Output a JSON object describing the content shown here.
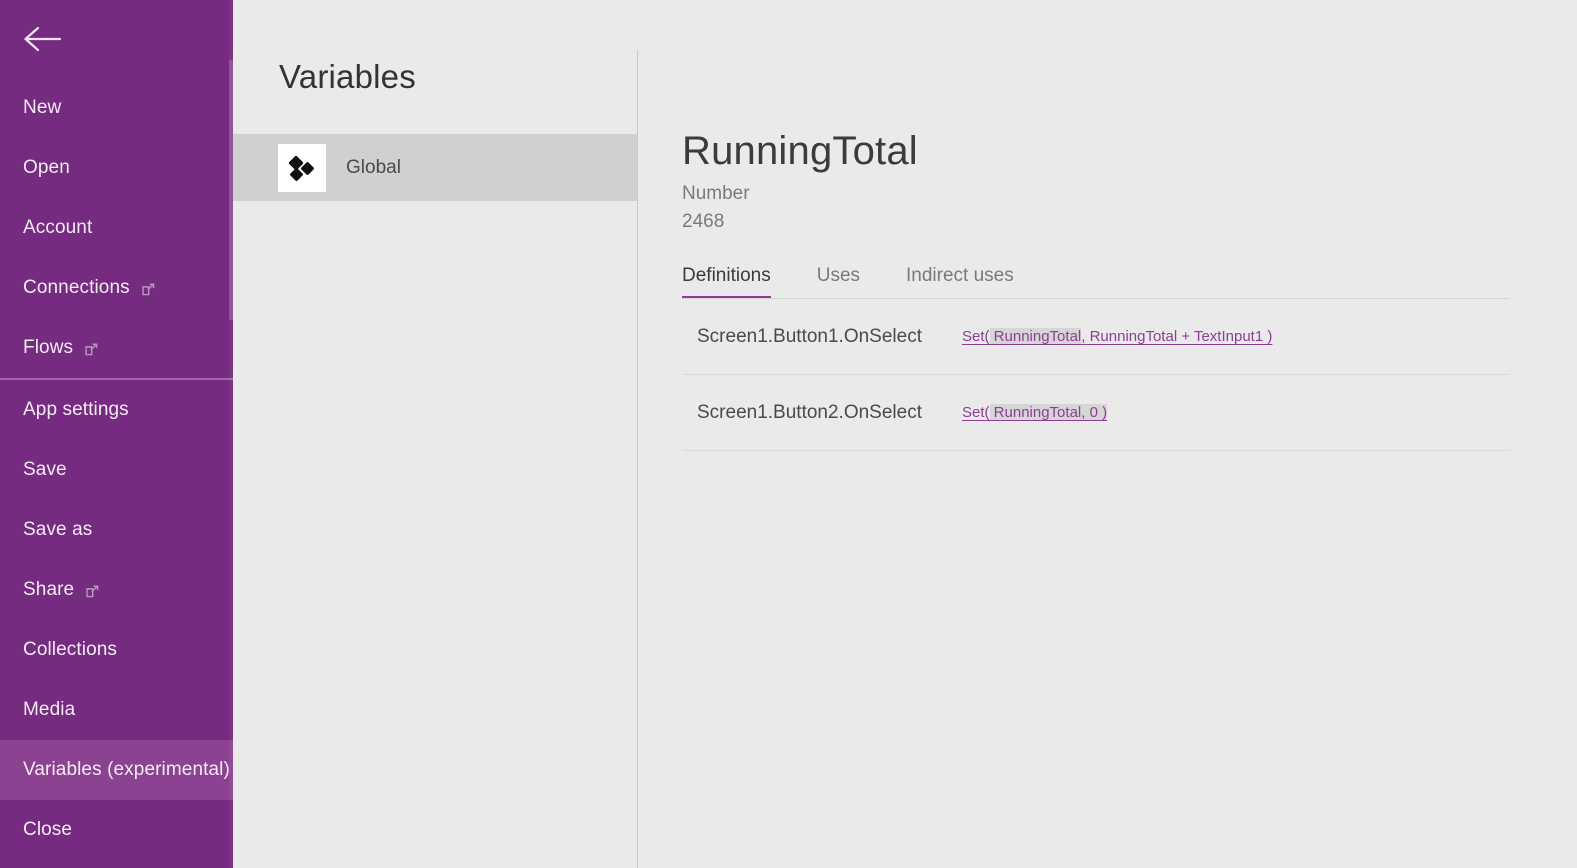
{
  "theme": {
    "sidebar_purple": "#752B7F",
    "sidebar_selected_purple": "#8B4391",
    "accent_purple": "#8C3E92",
    "panel_background": "#EAEAEA",
    "list_selected_gray": "#D0D0D0",
    "highlight_gray": "#D6D6D6"
  },
  "sidebar": {
    "back_icon": "back-arrow-icon",
    "items": [
      {
        "label": "New",
        "external": false,
        "selected": false,
        "separator_after": false
      },
      {
        "label": "Open",
        "external": false,
        "selected": false,
        "separator_after": false
      },
      {
        "label": "Account",
        "external": false,
        "selected": false,
        "separator_after": false
      },
      {
        "label": "Connections",
        "external": true,
        "selected": false,
        "separator_after": false
      },
      {
        "label": "Flows",
        "external": true,
        "selected": false,
        "separator_after": true
      },
      {
        "label": "App settings",
        "external": false,
        "selected": false,
        "separator_after": false
      },
      {
        "label": "Save",
        "external": false,
        "selected": false,
        "separator_after": false
      },
      {
        "label": "Save as",
        "external": false,
        "selected": false,
        "separator_after": false
      },
      {
        "label": "Share",
        "external": true,
        "selected": false,
        "separator_after": false
      },
      {
        "label": "Collections",
        "external": false,
        "selected": false,
        "separator_after": false
      },
      {
        "label": "Media",
        "external": false,
        "selected": false,
        "separator_after": false
      },
      {
        "label": "Variables (experimental)",
        "external": false,
        "selected": true,
        "separator_after": false
      },
      {
        "label": "Close",
        "external": false,
        "selected": false,
        "separator_after": false
      }
    ]
  },
  "variables_panel": {
    "title": "Variables",
    "items": [
      {
        "label": "Global",
        "icon": "global-variable-icon",
        "selected": true
      }
    ]
  },
  "detail": {
    "title": "RunningTotal",
    "type": "Number",
    "value": "2468",
    "tabs": [
      {
        "label": "Definitions",
        "active": true
      },
      {
        "label": "Uses",
        "active": false
      },
      {
        "label": "Indirect uses",
        "active": false
      }
    ],
    "rows": [
      {
        "target": "Screen1.Button1.OnSelect",
        "formula_prefix": "Set(",
        "formula_highlight": " RunningTotal",
        "formula_suffix": ", RunningTotal + TextInput1 )"
      },
      {
        "target": "Screen1.Button2.OnSelect",
        "formula_prefix": "Set(",
        "formula_highlight": " RunningTotal, 0 )",
        "formula_suffix": ""
      }
    ]
  }
}
